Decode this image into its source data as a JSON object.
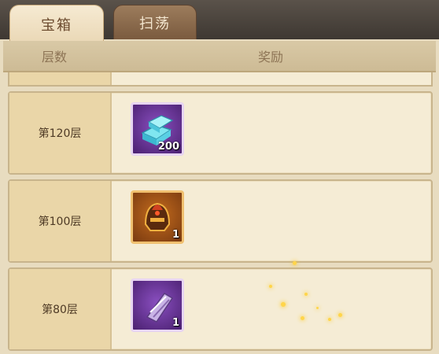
{
  "tabs": [
    {
      "label": "宝箱",
      "active": true
    },
    {
      "label": "扫荡",
      "active": false
    }
  ],
  "header": {
    "floor": "层数",
    "reward": "奖励"
  },
  "rows": [
    {
      "floor": "第120层",
      "item": {
        "icon": "crystal-ingot-icon",
        "quantity": "200",
        "rarity_color": "#8a4fc0"
      }
    },
    {
      "floor": "第100层",
      "item": {
        "icon": "helmet-icon",
        "quantity": "1",
        "rarity_color": "#c46c1e"
      }
    },
    {
      "floor": "第80层",
      "item": {
        "icon": "bracer-icon",
        "quantity": "1",
        "rarity_color": "#8a4fc0"
      }
    }
  ]
}
